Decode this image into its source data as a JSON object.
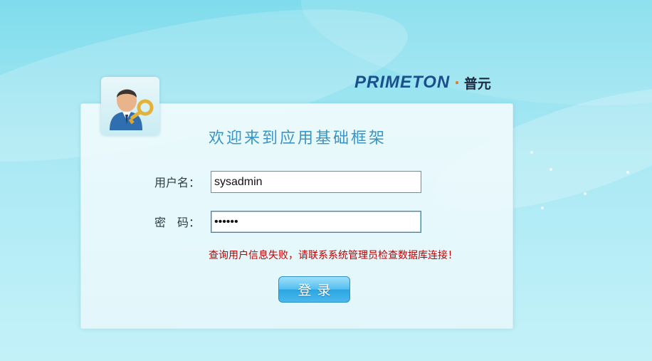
{
  "brand": {
    "name_latin": "PRIMETON",
    "separator": "·",
    "name_cn": "普元"
  },
  "login": {
    "title": "欢迎来到应用基础框架",
    "username_label": "用户名：",
    "password_label": "密　码：",
    "username_value": "sysadmin",
    "password_value": "••••••",
    "error_message": "查询用户信息失败，请联系系统管理员检查数据库连接！",
    "submit_label": "登录"
  },
  "icons": {
    "avatar": "user-key-icon"
  },
  "colors": {
    "title": "#3a95c4",
    "error": "#c00000",
    "button": "#2ba6e2",
    "brand": "#1a4f8c"
  }
}
